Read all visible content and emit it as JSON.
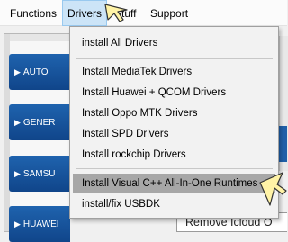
{
  "menubar": {
    "items": [
      {
        "label": "Functions"
      },
      {
        "label": "Drivers"
      },
      {
        "label": "Stuff"
      },
      {
        "label": "Support"
      }
    ]
  },
  "sidebar": {
    "items": [
      {
        "label": "AUTO"
      },
      {
        "label": "GENER"
      },
      {
        "label": "SAMSU"
      },
      {
        "label": "HUAWEI"
      }
    ]
  },
  "dropdown": {
    "items": [
      {
        "label": "install All Drivers"
      },
      {
        "label": "Install MediaTek Drivers"
      },
      {
        "label": "Install Huawei + QCOM Drivers"
      },
      {
        "label": "Install Oppo MTK Drivers"
      },
      {
        "label": "Install SPD Drivers"
      },
      {
        "label": "Install rockchip Drivers"
      },
      {
        "label": "Install Visual C++ All-In-One Runtimes"
      },
      {
        "label": "install/fix USBDK"
      }
    ]
  },
  "background": {
    "button_label": "Remove Icloud O"
  },
  "colors": {
    "menu_highlight": "#cce4f7",
    "hover_item": "#a7a7a7",
    "brand_blue": "#1a57a0",
    "cursor_yellow": "#fff3a6"
  }
}
